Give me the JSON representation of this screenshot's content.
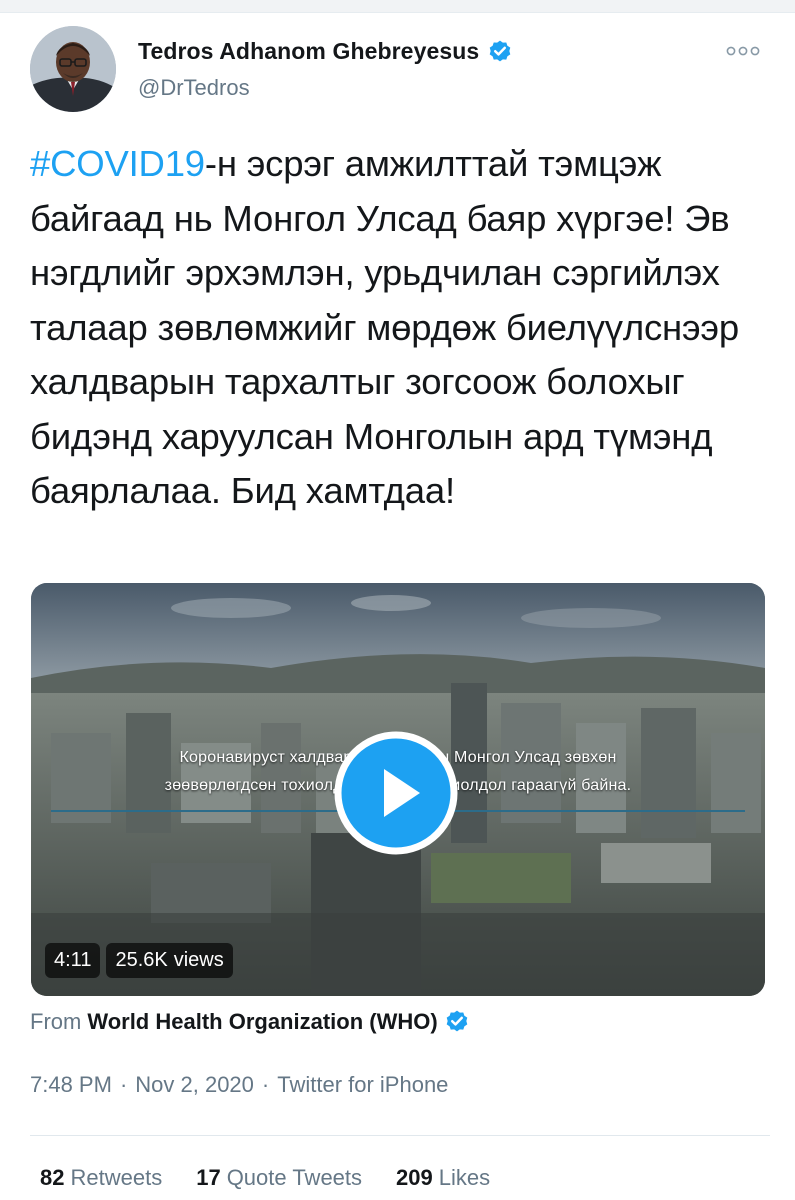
{
  "user": {
    "name": "Tedros Adhanom Ghebreyesus",
    "handle": "@DrTedros",
    "verified_color": "#1da1f2",
    "avatar_icon": "profile-photo"
  },
  "tweet": {
    "hashtag": "#COVID19",
    "text": "-н эсрэг амжилттай тэмцэж байгаад нь Монгол Улсад баяр хүргэе! Эв нэгдлийг эрхэмлэн, урьдчилан сэргийлэх талаар зөвлөмжийг мөрдөж биелүүлснээр халдварын тархалтыг зогсоож болохыг бидэнд харуулсан Монголын ард түмэнд баярлалаа. Бид хамтдаа!"
  },
  "video": {
    "subtitle_line1": "Коронавируст халдварын цар          хойш Монгол Улсад зөвхөн",
    "subtitle_line2": "зөөвөрлөгдсөн тохиолдол бүрт          ан тохиолдол гараагүй байна.",
    "duration": "4:11",
    "views_count": "25.6K",
    "views_label": "views",
    "play_icon": "play-icon"
  },
  "attribution": {
    "from_label": "From",
    "source": "World Health Organization (WHO)"
  },
  "meta": {
    "time": "7:48 PM",
    "separator": "·",
    "date": "Nov 2, 2020",
    "client": "Twitter for iPhone"
  },
  "stats": {
    "retweets_count": "82",
    "retweets_label": "Retweets",
    "quotes_count": "17",
    "quotes_label": "Quote Tweets",
    "likes_count": "209",
    "likes_label": "Likes"
  },
  "colors": {
    "accent": "#1da1f2",
    "secondary_text": "#657786",
    "primary_text": "#14171a"
  }
}
